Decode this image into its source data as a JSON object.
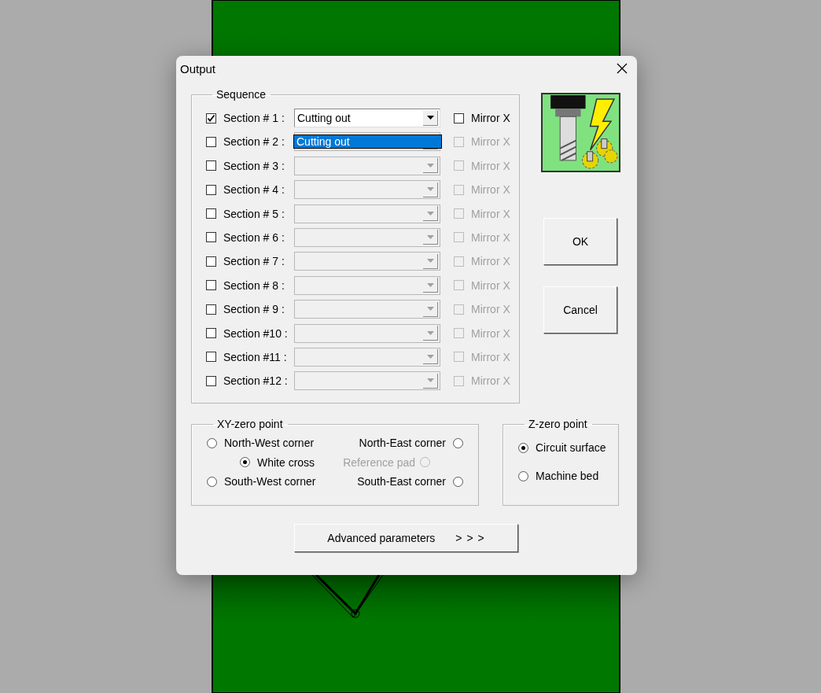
{
  "window": {
    "title": "Output"
  },
  "sequence": {
    "title": "Sequence",
    "sections": [
      {
        "label": "Section # 1 :",
        "checked": true,
        "disabled": false,
        "value": "Cutting out",
        "mirror_label": "Mirror X",
        "mirror_checked": false
      },
      {
        "label": "Section # 2 :",
        "checked": false,
        "disabled": true,
        "mirror_label": "Mirror X",
        "mirror_checked": false
      },
      {
        "label": "Section # 3 :",
        "checked": false,
        "disabled": true,
        "mirror_label": "Mirror X",
        "mirror_checked": false
      },
      {
        "label": "Section # 4 :",
        "checked": false,
        "disabled": true,
        "mirror_label": "Mirror X",
        "mirror_checked": false
      },
      {
        "label": "Section # 5 :",
        "checked": false,
        "disabled": true,
        "mirror_label": "Mirror X",
        "mirror_checked": false
      },
      {
        "label": "Section # 6 :",
        "checked": false,
        "disabled": true,
        "mirror_label": "Mirror X",
        "mirror_checked": false
      },
      {
        "label": "Section # 7 :",
        "checked": false,
        "disabled": true,
        "mirror_label": "Mirror X",
        "mirror_checked": false
      },
      {
        "label": "Section # 8 :",
        "checked": false,
        "disabled": true,
        "mirror_label": "Mirror X",
        "mirror_checked": false
      },
      {
        "label": "Section # 9 :",
        "checked": false,
        "disabled": true,
        "mirror_label": "Mirror X",
        "mirror_checked": false
      },
      {
        "label": "Section #10 :",
        "checked": false,
        "disabled": true,
        "mirror_label": "Mirror X",
        "mirror_checked": false
      },
      {
        "label": "Section #11 :",
        "checked": false,
        "disabled": true,
        "mirror_label": "Mirror X",
        "mirror_checked": false
      },
      {
        "label": "Section #12 :",
        "checked": false,
        "disabled": true,
        "mirror_label": "Mirror X",
        "mirror_checked": false
      }
    ]
  },
  "dropdown_list": {
    "items": [
      {
        "label": "Cutting out",
        "selected": true
      }
    ]
  },
  "buttons": [
    {
      "label": "OK"
    },
    {
      "label": "Cancel"
    }
  ],
  "xy_zero": {
    "title": "XY-zero point",
    "options": [
      {
        "label": "North-West corner",
        "kind": "corner",
        "selected": false,
        "disabled": false
      },
      {
        "label": "North-East corner",
        "kind": "corner",
        "selected": false,
        "disabled": false
      },
      {
        "label": "White cross",
        "kind": "center",
        "selected": true,
        "disabled": false
      },
      {
        "label": "Reference pad",
        "kind": "center",
        "selected": false,
        "disabled": true
      },
      {
        "label": "South-West corner",
        "kind": "corner",
        "selected": false,
        "disabled": false
      },
      {
        "label": "South-East corner",
        "kind": "corner",
        "selected": false,
        "disabled": false
      }
    ]
  },
  "z_zero": {
    "title": "Z-zero point",
    "options": [
      {
        "label": "Circuit surface",
        "selected": true,
        "disabled": false
      },
      {
        "label": "Machine bed",
        "selected": false,
        "disabled": false
      }
    ]
  },
  "advanced_button": {
    "label": "Advanced parameters",
    "arrows": "> > >"
  }
}
